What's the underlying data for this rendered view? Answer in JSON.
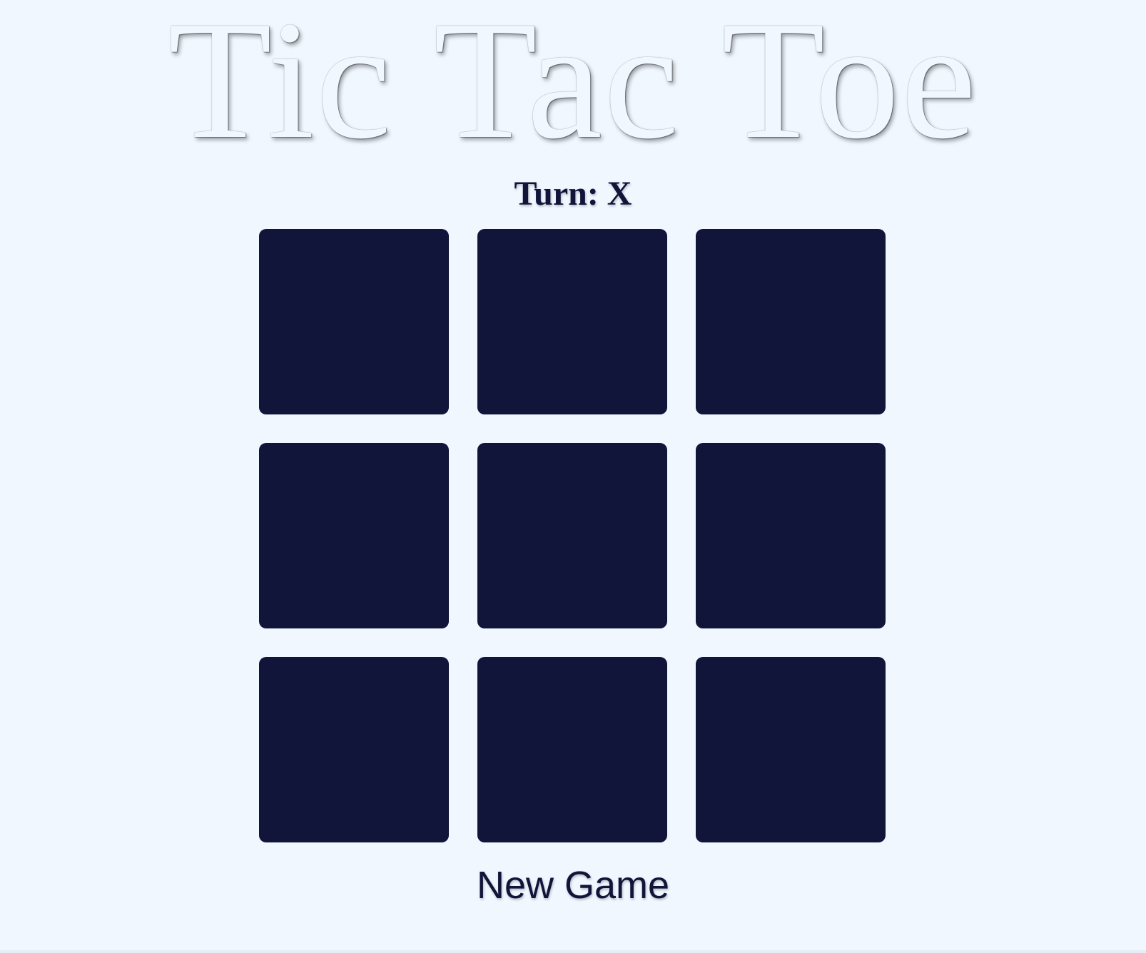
{
  "title": "Tic Tac Toe",
  "status": {
    "label": "Turn: X"
  },
  "board": {
    "cells": [
      "",
      "",
      "",
      "",
      "",
      "",
      "",
      "",
      ""
    ]
  },
  "controls": {
    "new_game_label": "New Game"
  },
  "colors": {
    "background": "#f0f7ff",
    "cell": "#11153a",
    "text": "#11153a"
  }
}
